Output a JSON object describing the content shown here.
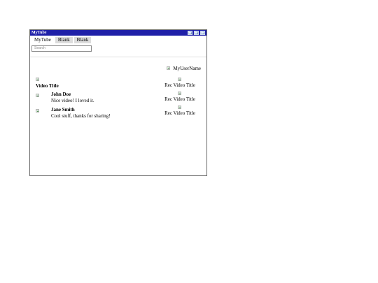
{
  "window": {
    "title": "MyTube",
    "title_buttons": [
      "minimize-icon",
      "maximize-icon",
      "close-icon"
    ]
  },
  "tabs": [
    {
      "label": "MyTube",
      "active": true
    },
    {
      "label": "Blank",
      "active": false
    },
    {
      "label": "Blank",
      "active": false
    }
  ],
  "search": {
    "placeholder": "Search",
    "value": ""
  },
  "user": {
    "name": "MyUserName",
    "avatar_icon": "user-avatar-icon"
  },
  "video": {
    "thumbnail_icon": "video-thumbnail-icon",
    "title": "Video Title"
  },
  "comments": [
    {
      "author": "John Doe",
      "text": "Nice video! I loved it.",
      "avatar_icon": "commenter-avatar-icon"
    },
    {
      "author": "Jane Smith",
      "text": "Cool stuff, thanks for sharing!",
      "avatar_icon": "commenter-avatar-icon"
    }
  ],
  "recommendations": [
    {
      "title": "Rec Video Title",
      "thumbnail_icon": "rec-thumbnail-icon"
    },
    {
      "title": "Rec Video Title",
      "thumbnail_icon": "rec-thumbnail-icon"
    },
    {
      "title": "Rec Video Title",
      "thumbnail_icon": "rec-thumbnail-icon"
    }
  ],
  "colors": {
    "titlebar": "#1f20a8",
    "tab_inactive": "#dcdcdc"
  }
}
